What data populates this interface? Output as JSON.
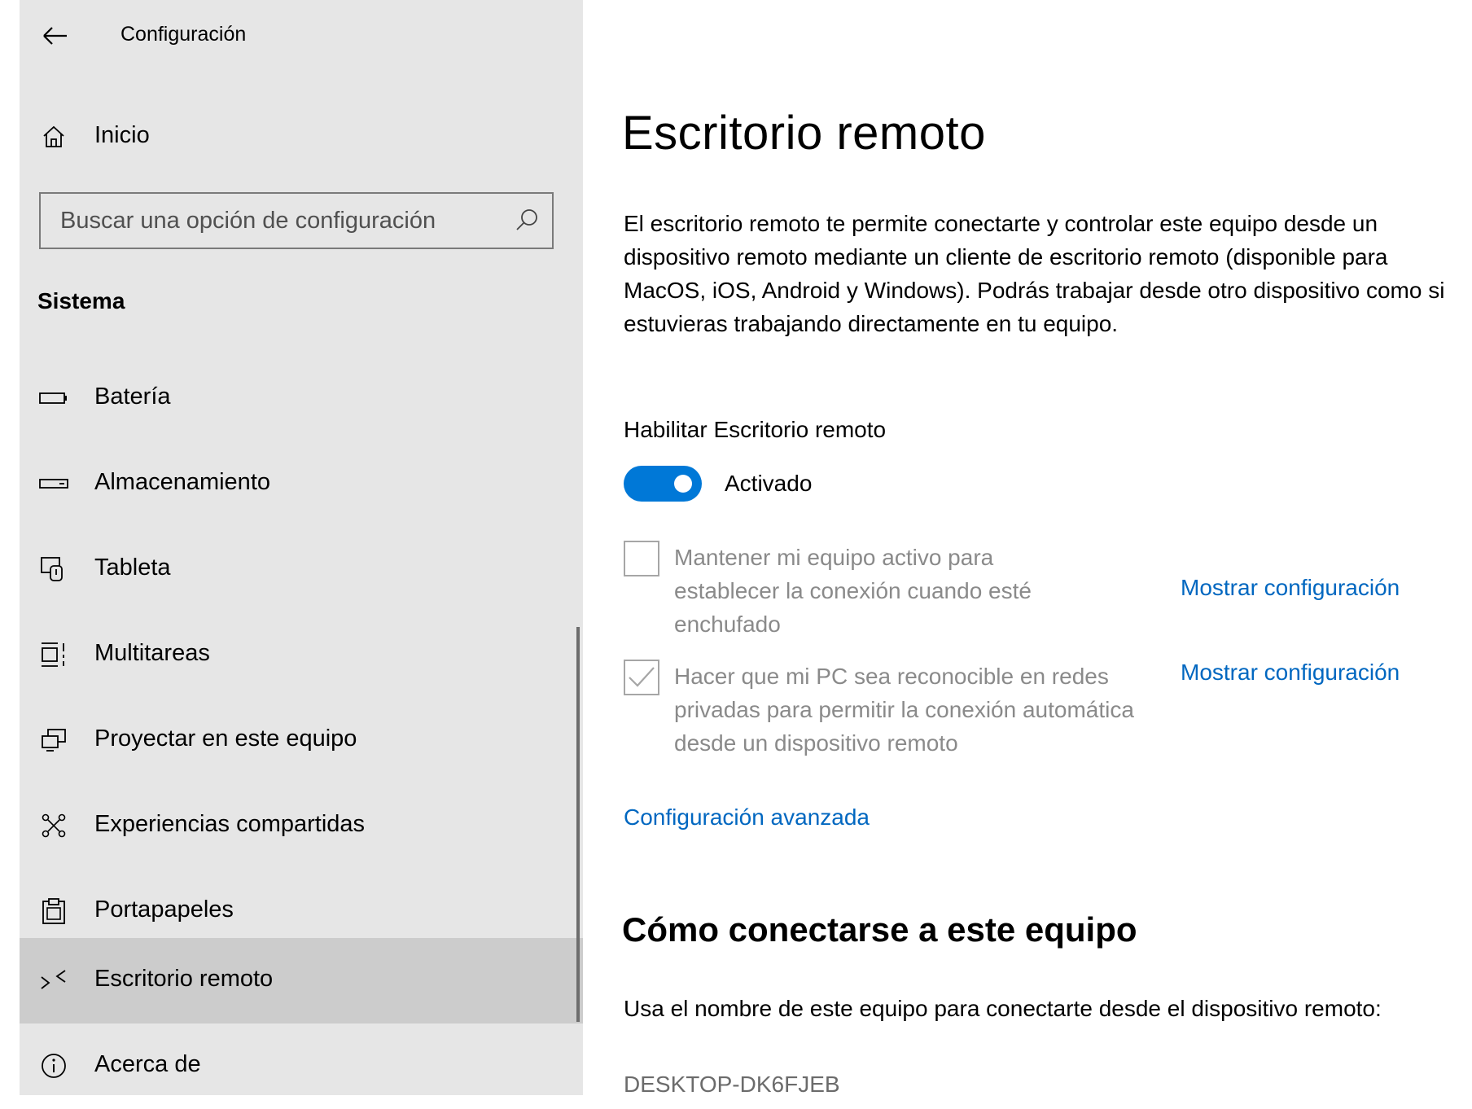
{
  "window": {
    "title": "Configuración"
  },
  "sidebar": {
    "home_label": "Inicio",
    "search_placeholder": "Buscar una opción de configuración",
    "section_title": "Sistema",
    "items": [
      {
        "label": "Batería",
        "icon": "battery-icon",
        "selected": false
      },
      {
        "label": "Almacenamiento",
        "icon": "storage-icon",
        "selected": false
      },
      {
        "label": "Tableta",
        "icon": "tablet-icon",
        "selected": false
      },
      {
        "label": "Multitareas",
        "icon": "multitasking-icon",
        "selected": false
      },
      {
        "label": "Proyectar en este equipo",
        "icon": "project-icon",
        "selected": false
      },
      {
        "label": "Experiencias compartidas",
        "icon": "shared-experiences-icon",
        "selected": false
      },
      {
        "label": "Portapapeles",
        "icon": "clipboard-icon",
        "selected": false
      },
      {
        "label": "Escritorio remoto",
        "icon": "remote-desktop-icon",
        "selected": true
      },
      {
        "label": "Acerca de",
        "icon": "info-icon",
        "selected": false
      }
    ]
  },
  "main": {
    "title": "Escritorio remoto",
    "description": "El escritorio remoto te permite conectarte y controlar este equipo desde un dispositivo remoto mediante un cliente de escritorio remoto (disponible para MacOS, iOS, Android y Windows). Podrás trabajar desde otro dispositivo como si estuvieras trabajando directamente en tu equipo.",
    "toggle": {
      "label": "Habilitar Escritorio remoto",
      "state_text": "Activado",
      "on": true
    },
    "options": [
      {
        "text": "Mantener mi equipo activo para establecer la conexión cuando esté enchufado",
        "checked": false,
        "link": "Mostrar configuración"
      },
      {
        "text": "Hacer que mi PC sea reconocible en redes privadas para permitir la conexión automática desde un dispositivo remoto",
        "checked": true,
        "link": "Mostrar configuración"
      }
    ],
    "advanced_link": "Configuración avanzada",
    "connect_title": "Cómo conectarse a este equipo",
    "connect_text": "Usa el nombre de este equipo para conectarte desde el dispositivo remoto:",
    "pc_name": "DESKTOP-DK6FJEB"
  },
  "colors": {
    "accent": "#0078d7",
    "link": "#0067c0",
    "sidebar_bg": "#e6e6e6",
    "selected_bg": "#cccccc"
  }
}
